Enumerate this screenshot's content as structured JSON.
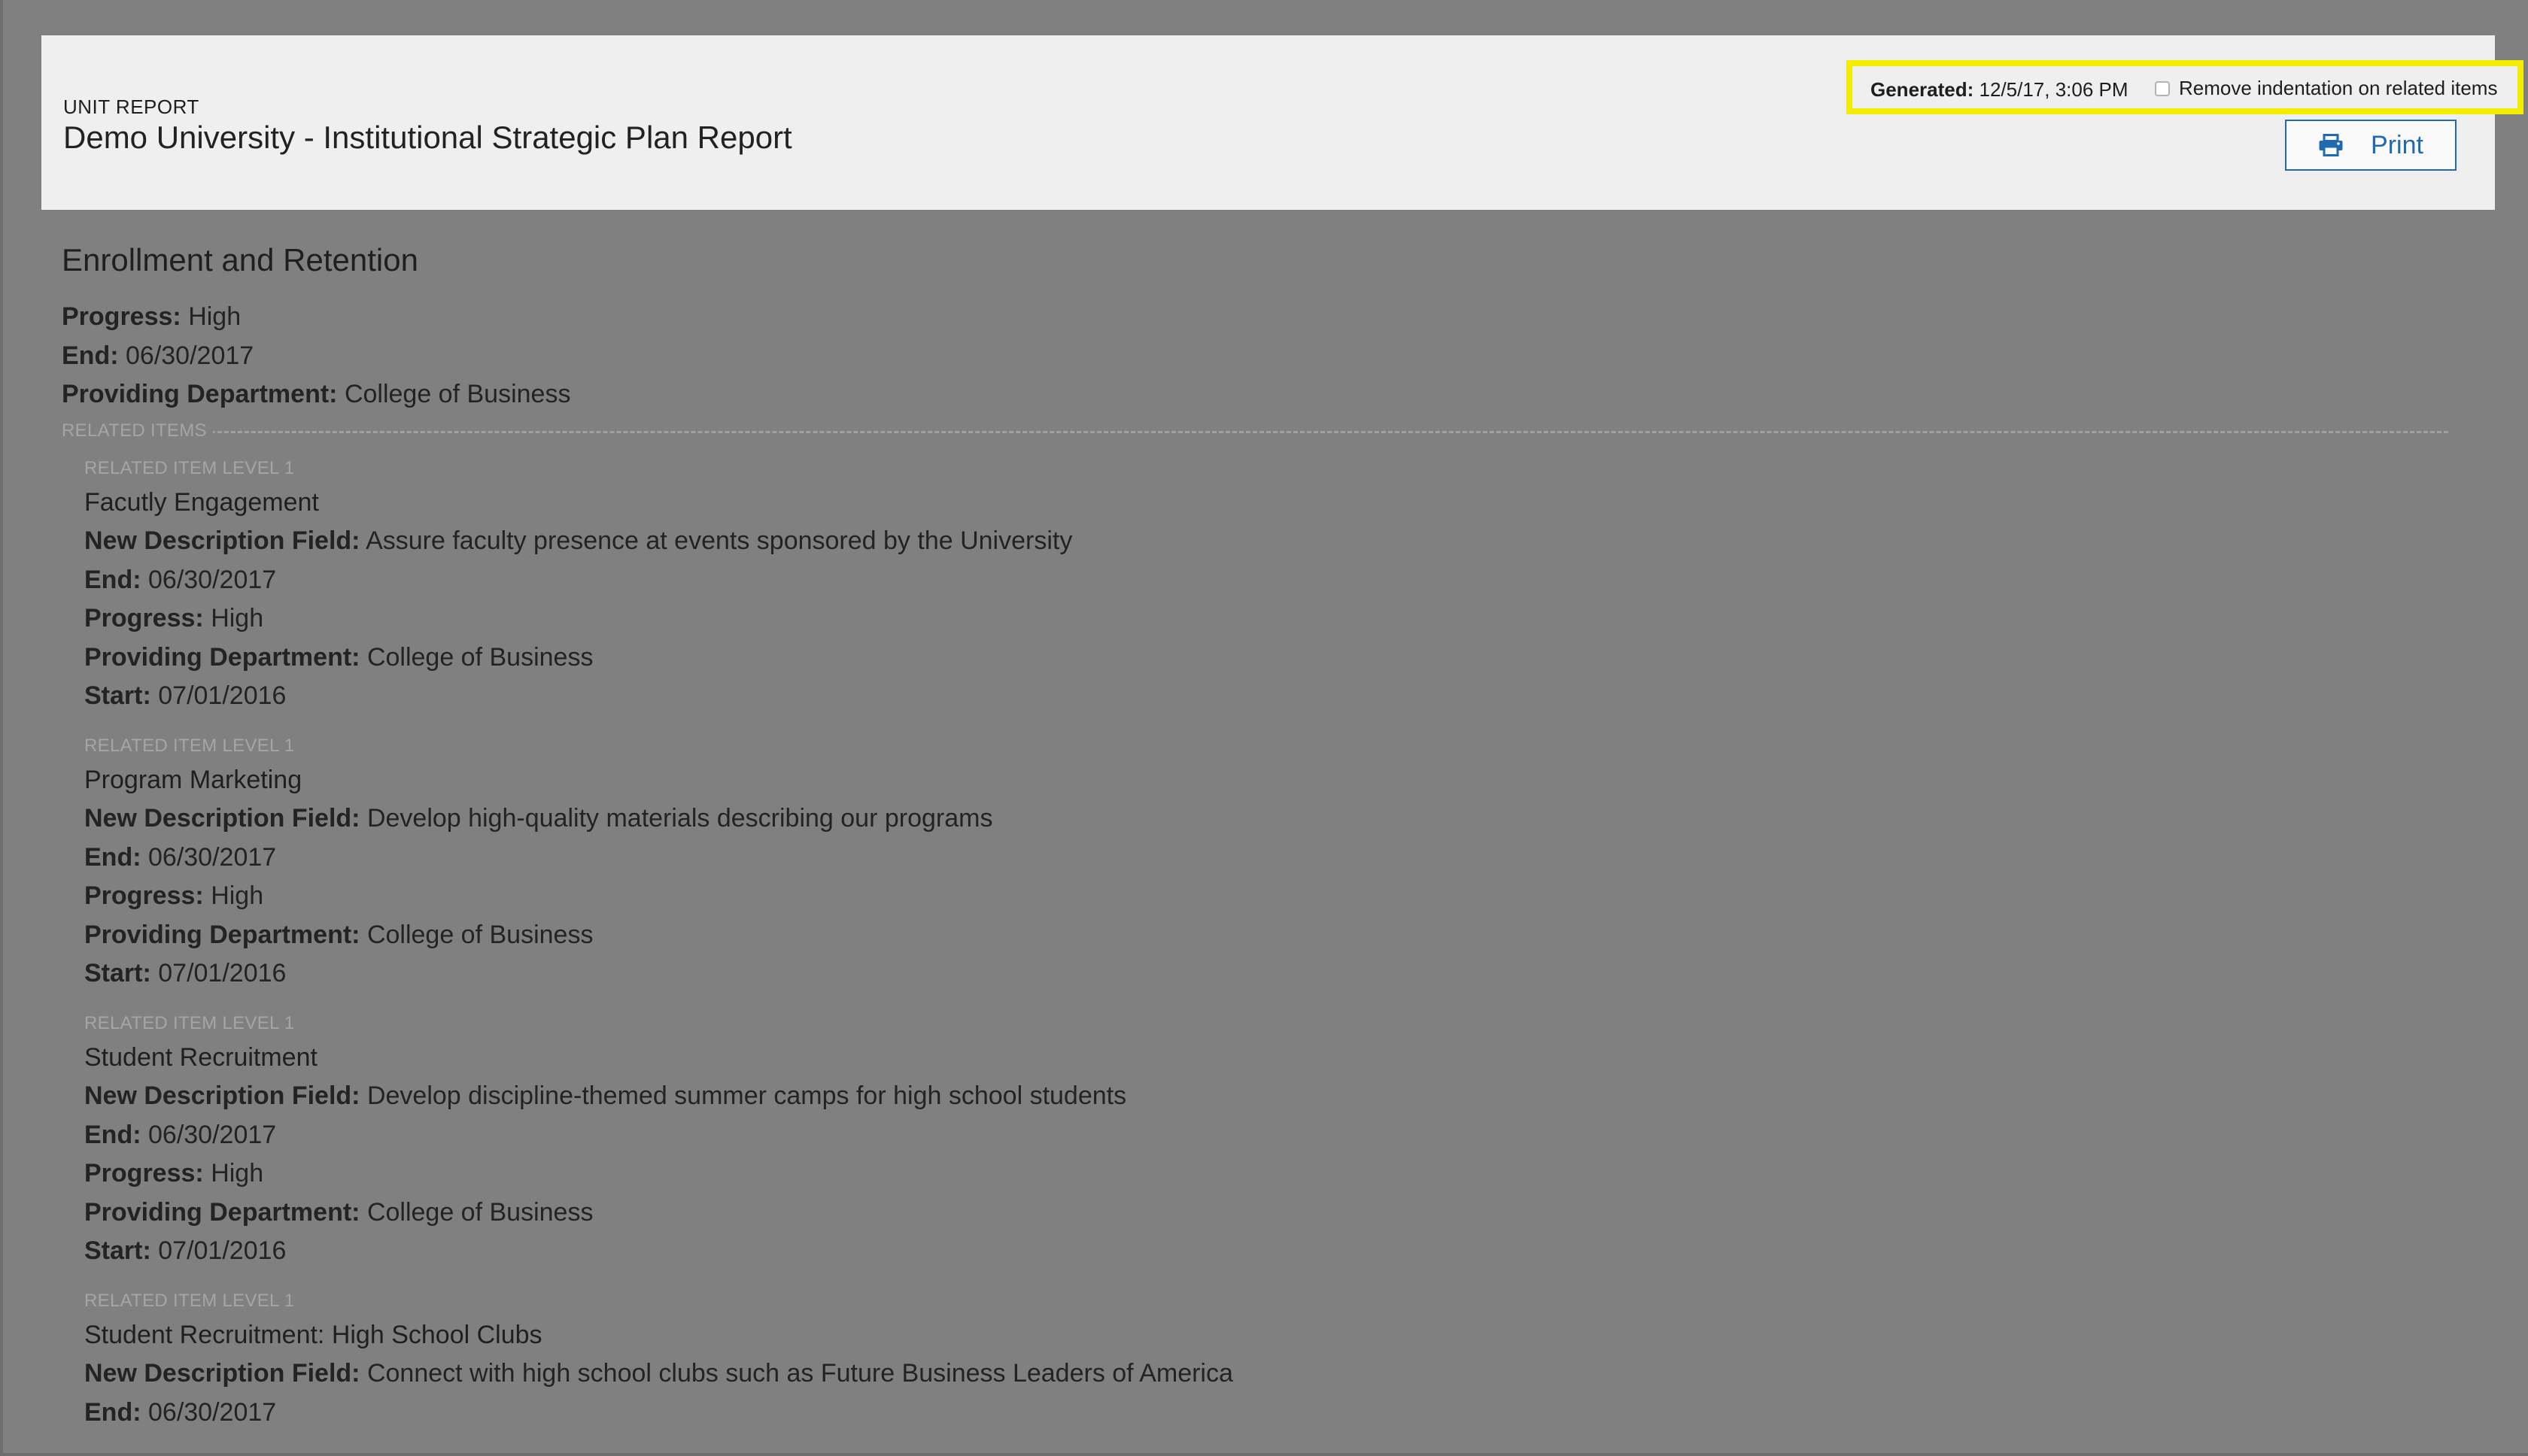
{
  "header": {
    "report_type": "UNIT REPORT",
    "title": "Demo University - Institutional Strategic Plan Report",
    "generated_label": "Generated:",
    "generated_value": "12/5/17, 3:06 PM",
    "indent_toggle_label": "Remove indentation on related items",
    "indent_toggle_checked": false,
    "print_label": "Print",
    "highlight_color": "#f4ed00",
    "accent_color": "#1f6ab1"
  },
  "main": {
    "title": "Enrollment and Retention",
    "fields": [
      {
        "label": "Progress:",
        "value": "High"
      },
      {
        "label": "End:",
        "value": "06/30/2017"
      },
      {
        "label": "Providing Department:",
        "value": "College of Business"
      }
    ],
    "related_label": "RELATED ITEMS"
  },
  "items": [
    {
      "level": "RELATED ITEM LEVEL 1",
      "title": "Facutly Engagement",
      "fields": [
        {
          "label": "New Description Field:",
          "value": "Assure faculty presence at events sponsored by the University"
        },
        {
          "label": "End:",
          "value": "06/30/2017"
        },
        {
          "label": "Progress:",
          "value": "High"
        },
        {
          "label": "Providing Department:",
          "value": "College of Business"
        },
        {
          "label": "Start:",
          "value": "07/01/2016"
        }
      ]
    },
    {
      "level": "RELATED ITEM LEVEL 1",
      "title": "Program Marketing",
      "fields": [
        {
          "label": "New Description Field:",
          "value": "Develop high-quality materials describing our programs"
        },
        {
          "label": "End:",
          "value": "06/30/2017"
        },
        {
          "label": "Progress:",
          "value": "High"
        },
        {
          "label": "Providing Department:",
          "value": "College of Business"
        },
        {
          "label": "Start:",
          "value": "07/01/2016"
        }
      ]
    },
    {
      "level": "RELATED ITEM LEVEL 1",
      "title": "Student Recruitment",
      "fields": [
        {
          "label": "New Description Field:",
          "value": "Develop discipline-themed summer camps for high school students"
        },
        {
          "label": "End:",
          "value": "06/30/2017"
        },
        {
          "label": "Progress:",
          "value": "High"
        },
        {
          "label": "Providing Department:",
          "value": "College of Business"
        },
        {
          "label": "Start:",
          "value": "07/01/2016"
        }
      ]
    },
    {
      "level": "RELATED ITEM LEVEL 1",
      "title": "Student Recruitment: High School Clubs",
      "fields": [
        {
          "label": "New Description Field:",
          "value": "Connect with high school clubs such as Future Business Leaders of America"
        },
        {
          "label": "End:",
          "value": "06/30/2017"
        }
      ]
    }
  ]
}
